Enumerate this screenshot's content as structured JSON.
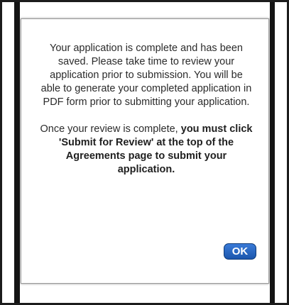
{
  "dialog": {
    "paragraph_1": "Your application is complete and has been saved. Please take time to review your application prior to submission. You will be able to generate your completed application in PDF form prior to submitting your application.",
    "paragraph_2_plain": "Once your review is complete,",
    "paragraph_2_bold": "you must click 'Submit for Review' at the top of the Agreements page to submit your application.",
    "ok_label": "OK"
  },
  "colors": {
    "ok_button": "#1b56ad",
    "backdrop_link": "#1f3d7a"
  }
}
